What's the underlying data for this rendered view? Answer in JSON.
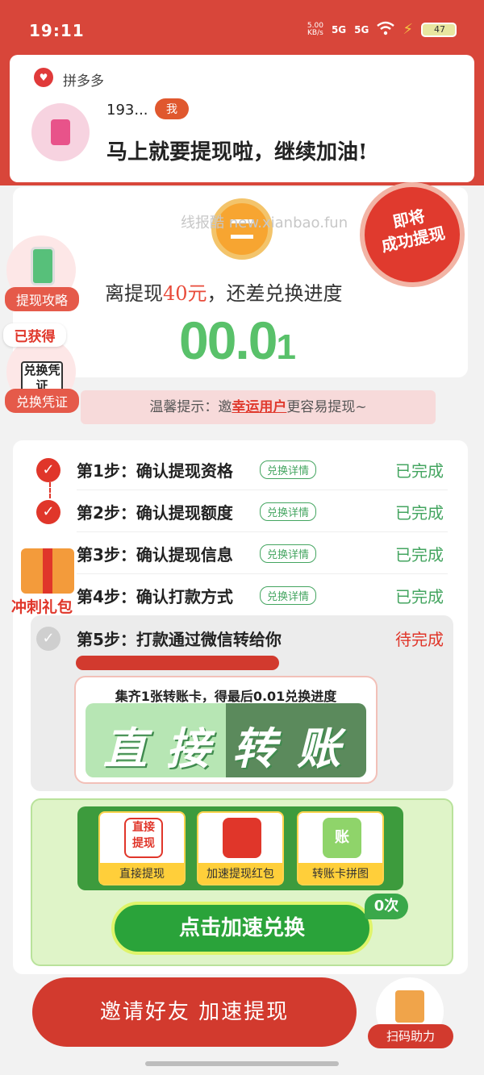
{
  "status_bar": {
    "time": "19:11",
    "net_speed_value": "5.00",
    "net_speed_unit": "KB/s",
    "sim1": "5G",
    "sim2": "5G",
    "battery": "47"
  },
  "notification": {
    "app_name": "拼多多",
    "user": "193...",
    "tag": "我",
    "message": "马上就要提现啦，继续加油!"
  },
  "watermark": "线报酷 new.xianbao.fun",
  "progress_card": {
    "badge_line1": "即将",
    "badge_line2": "成功提现",
    "distance_prefix": "离提现",
    "distance_amount": "40元",
    "distance_suffix": "，还差兑换进度",
    "progress_main": "00.0",
    "progress_tail": "1"
  },
  "side_buttons": {
    "strategy": "提现攻略",
    "obtained": "已获得",
    "voucher_icon_text": "兑换凭证",
    "voucher": "兑换凭证"
  },
  "tip": {
    "prefix": "温馨提示：邀",
    "highlight": "幸运用户",
    "suffix": "更容易提现~"
  },
  "steps": [
    {
      "label": "第1步：确认提现资格",
      "detail": "兑换详情",
      "state": "已完成",
      "done": true
    },
    {
      "label": "第2步：确认提现额度",
      "detail": "兑换详情",
      "state": "已完成",
      "done": true
    },
    {
      "label": "第3步：确认提现信息",
      "detail": "兑换详情",
      "state": "已完成",
      "done": true
    },
    {
      "label": "第4步：确认打款方式",
      "detail": "兑换详情",
      "state": "已完成",
      "done": true
    },
    {
      "label": "第5步：打款通过微信转给你",
      "detail": "",
      "state": "待完成",
      "done": false
    }
  ],
  "gift": {
    "label": "冲刺礼包"
  },
  "transfer": {
    "collect_text": "集齐1张转账卡，得最后0.01兑换进度",
    "chars": [
      "直",
      "接",
      "转",
      "账"
    ]
  },
  "tools": [
    {
      "label": "直接提现",
      "icon": "直接\n提现"
    },
    {
      "label": "加速提现红包",
      "icon": ""
    },
    {
      "label": "转账卡拼图",
      "icon": "账"
    }
  ],
  "exchange_button": "点击加速兑换",
  "exchange_count": "0次",
  "invite_button": "邀请好友 加速提现",
  "scan_button": "扫码助力"
}
